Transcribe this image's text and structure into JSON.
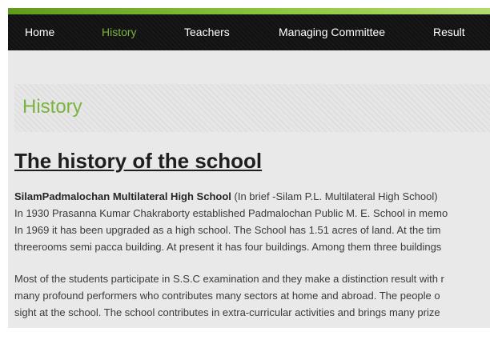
{
  "nav": {
    "items": [
      {
        "label": "Home",
        "active": false
      },
      {
        "label": "History",
        "active": true
      },
      {
        "label": "Teachers",
        "active": false
      },
      {
        "label": "Managing Committee",
        "active": false
      },
      {
        "label": "Result",
        "active": false
      }
    ]
  },
  "section": {
    "title": "History"
  },
  "page": {
    "heading": "The history of the school"
  },
  "paragraph1": {
    "school_name": "SilamPadmalochan Multilateral High School",
    "line1_rest": " (In brief -Silam P.L. Multilateral High School)",
    "lines": [
      "In 1930 Prasanna Kumar Chakraborty established Padmalochan Public M. E. School in memo",
      "In 1969 it has been upgraded as a high school. The School has 1.51 acres of land. At the tim",
      "threerooms semi pacca building. At present it has four buildings. Among them three buildings"
    ]
  },
  "paragraph2": {
    "lines": [
      "Most of the students participate in S.S.C examination and they make a distinction result with r",
      "many profound performers who contributes many sectors at home and abroad. The people o",
      "sight at the school. The school contributes in extra-curricular activities and brings many prize"
    ]
  },
  "colors": {
    "accent_green": "#7ab340",
    "navbar_bg": "#121212",
    "content_bg": "#e9e9e9"
  }
}
